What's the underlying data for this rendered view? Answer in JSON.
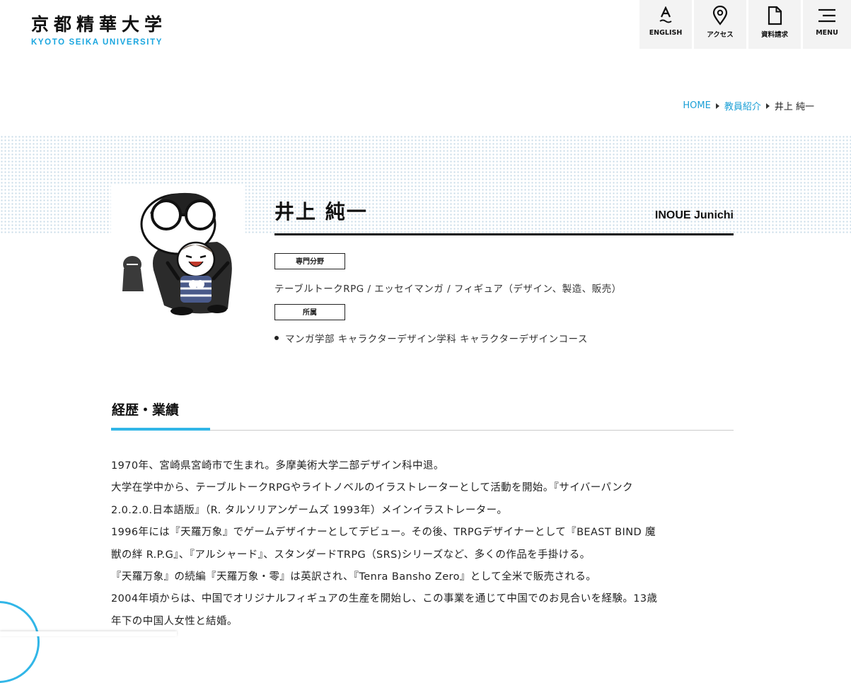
{
  "header": {
    "logo_jp": "京都精華大学",
    "logo_en": "KYOTO SEIKA UNIVERSITY",
    "nav": [
      {
        "label": "ENGLISH",
        "icon": "language-icon"
      },
      {
        "label": "アクセス",
        "icon": "map-pin-icon"
      },
      {
        "label": "資料請求",
        "icon": "document-icon"
      },
      {
        "label": "MENU",
        "icon": "menu-icon"
      }
    ]
  },
  "breadcrumb": {
    "home": "HOME",
    "parent": "教員紹介",
    "current": "井上 純一"
  },
  "profile": {
    "name_jp": "井上 純一",
    "name_en": "INOUE Junichi",
    "field_label": "専門分野",
    "field_text": "テーブルトークRPG / エッセイマンガ / フィギュア（デザイン、製造、販売）",
    "affiliation_label": "所属",
    "affiliations": [
      "マンガ学部 キャラクターデザイン学科 キャラクターデザインコース"
    ]
  },
  "section": {
    "title": "経歴・業績",
    "lines": [
      "1970年、宮崎県宮崎市で生まれ。多摩美術大学二部デザイン科中退。",
      "大学在学中から、テーブルトークRPGやライトノベルのイラストレーターとして活動を開始。『サイバーパンク",
      "2.0.2.0.日本語版』（R. タルソリアンゲームズ 1993年）メインイラストレーター。",
      "1996年には『天羅万象』でゲームデザイナーとしてデビュー。その後、TRPGデザイナーとして『BEAST BIND 魔",
      "獣の絆 R.P.G』、『アルシャード』、スタンダードTRPG（SRS)シリーズなど、多くの作品を手掛ける。",
      "『天羅万象』の続編『天羅万象・零』は英訳され、『Tenra Bansho Zero』として全米で販売される。",
      "2004年頃からは、中国でオリジナルフィギュアの生産を開始し、この事業を通じて中国でのお見合いを経験。13歳",
      "年下の中国人女性と結婚。"
    ]
  },
  "colors": {
    "accent": "#1aa6df",
    "underline": "#31b6e7",
    "dots": "#c9dbe8"
  }
}
